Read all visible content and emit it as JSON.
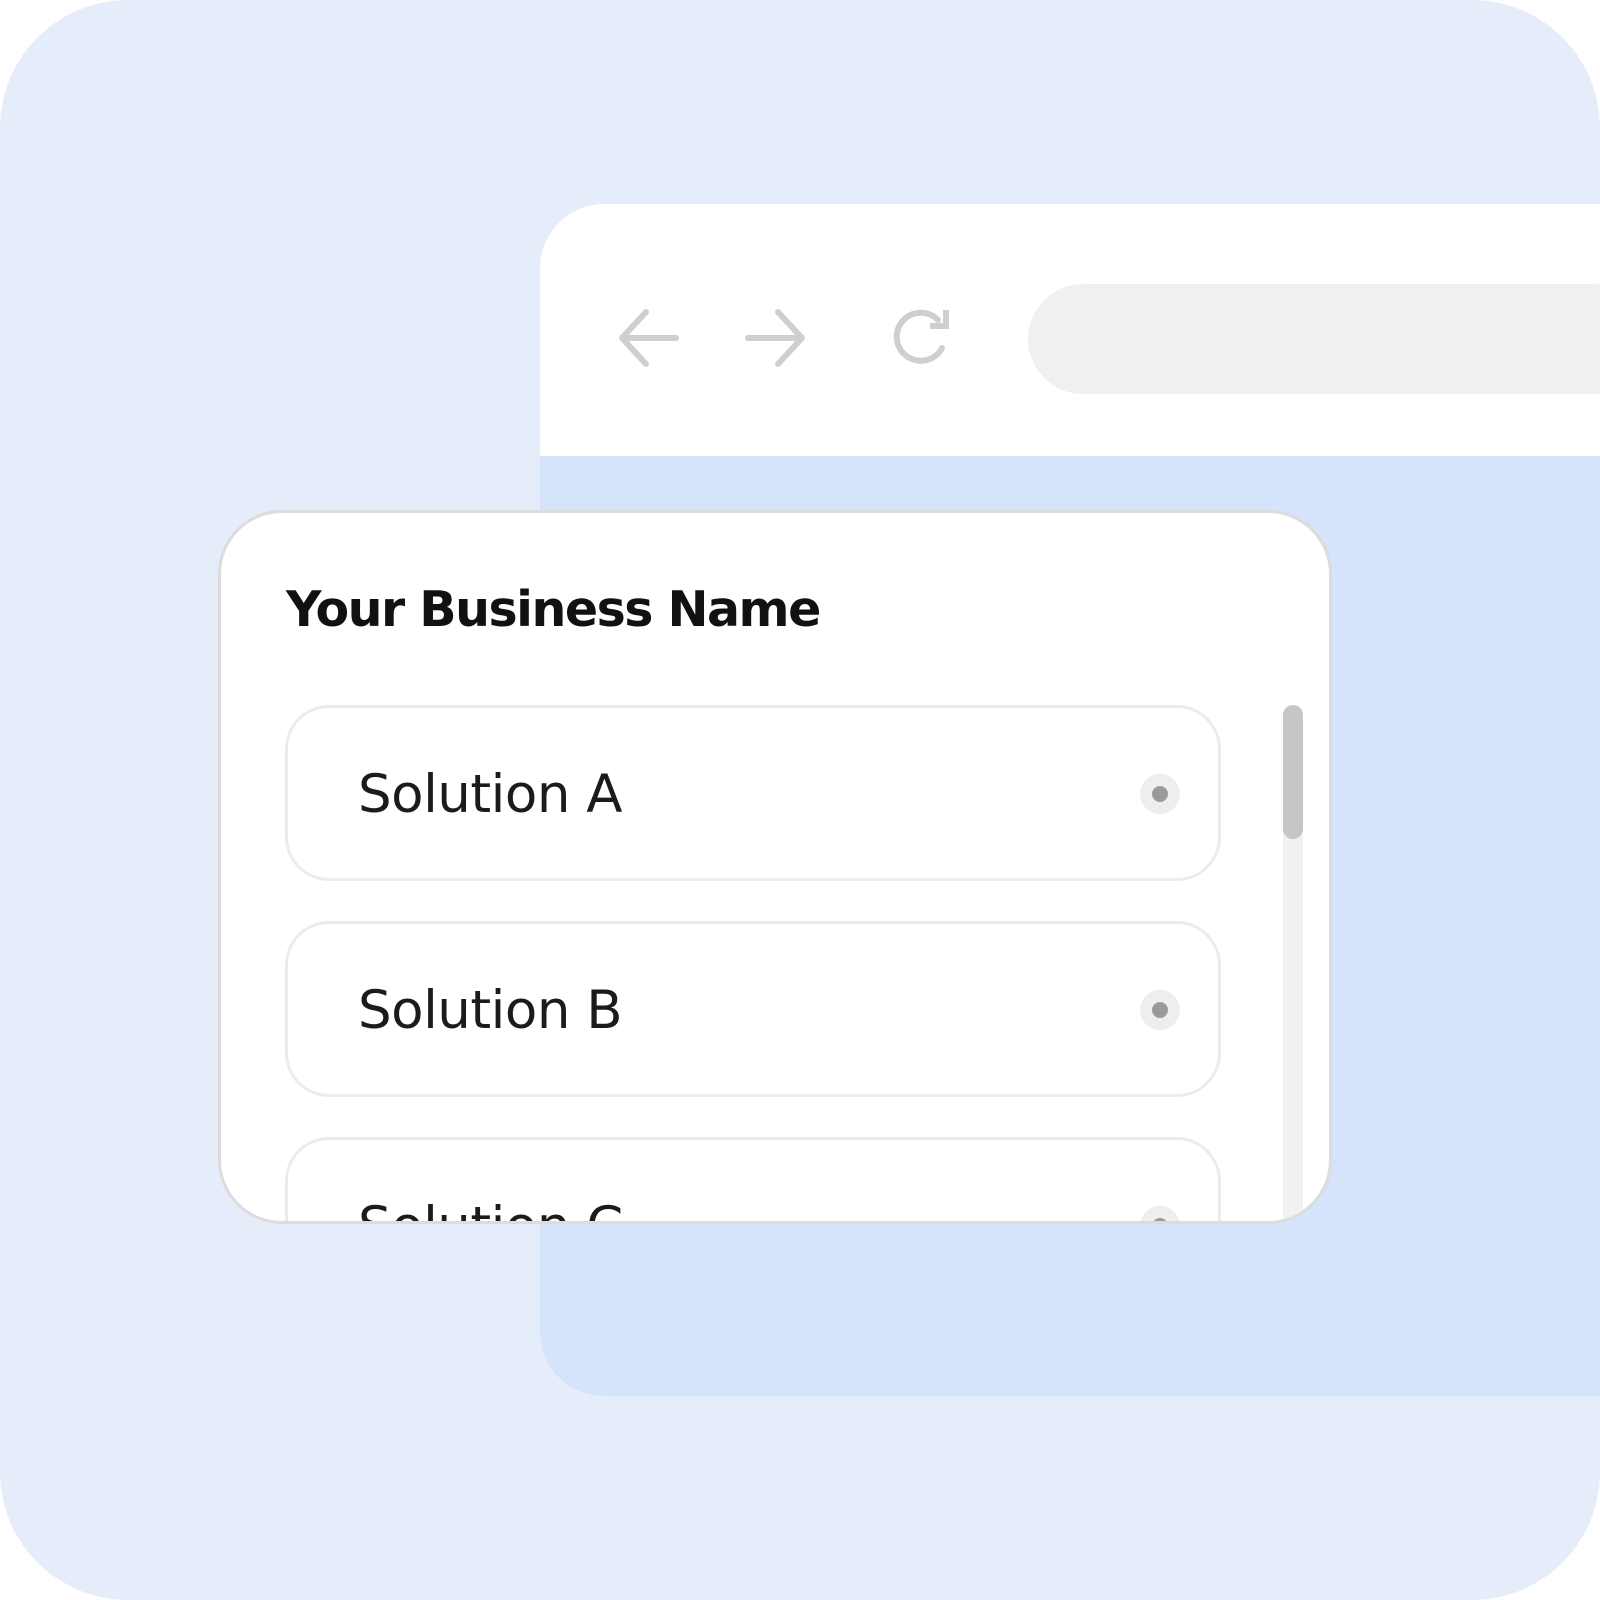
{
  "browser": {
    "icons": {
      "back": "arrow-left-icon",
      "forward": "arrow-right-icon",
      "reload": "reload-icon"
    },
    "address_bar": {
      "value": ""
    }
  },
  "card": {
    "title": "Your Business Name",
    "options": [
      {
        "label": "Solution A",
        "selected": false
      },
      {
        "label": "Solution B",
        "selected": false
      },
      {
        "label": "Solution C",
        "selected": false
      }
    ],
    "scroll_position": 0
  },
  "colors": {
    "background": "#e5edfb",
    "browser_content": "#d5e3fb",
    "card": "#ffffff",
    "address_bar": "#eff0f2",
    "title_text": "#111111",
    "icon_gray": "#cfcfcf"
  }
}
